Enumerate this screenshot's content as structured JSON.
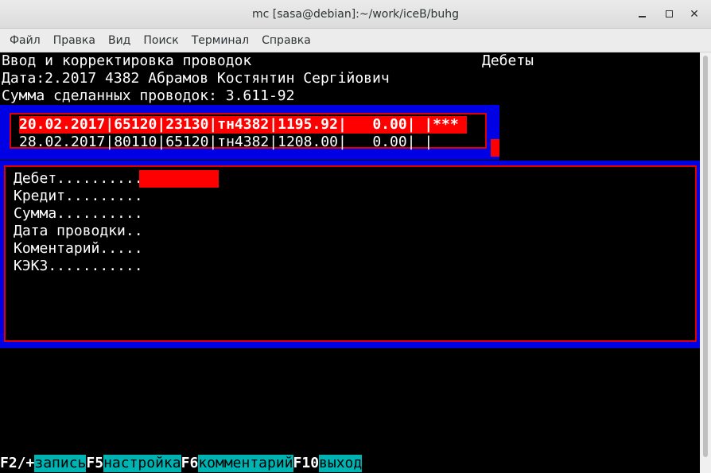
{
  "window": {
    "title": "mc [sasa@debian]:~/work/iceB/buhg"
  },
  "menu": [
    "Файл",
    "Правка",
    "Вид",
    "Поиск",
    "Терминал",
    "Справка"
  ],
  "header": {
    "line1": "Ввод и корректировка проводок",
    "mode": "Дебеты",
    "line2": "Дата:2.2017 4382 Абрамов Костянтин Сергійович",
    "line3": "Сумма сделанных проводок: 3.611-92"
  },
  "entries": [
    {
      "text": "20.02.2017|65120|23130|тн4382|1195.92|   0.00| |***"
    },
    {
      "text": "28.02.2017|80110|65120|тн4382|1208.00|   0.00| |"
    }
  ],
  "form": {
    "fields": [
      {
        "label": "Дебет.........."
      },
      {
        "label": "Кредит........."
      },
      {
        "label": "Сумма.........."
      },
      {
        "label": "Дата проводки.."
      },
      {
        "label": "Коментарий....."
      },
      {
        "label": "КЭКЗ..........."
      }
    ]
  },
  "fkeys": [
    {
      "key": "F2/+",
      "label": "запись"
    },
    {
      "key": "F5",
      "label": "настройка"
    },
    {
      "key": "F6",
      "label": "комментарий"
    },
    {
      "key": "F10",
      "label": "выход"
    }
  ]
}
